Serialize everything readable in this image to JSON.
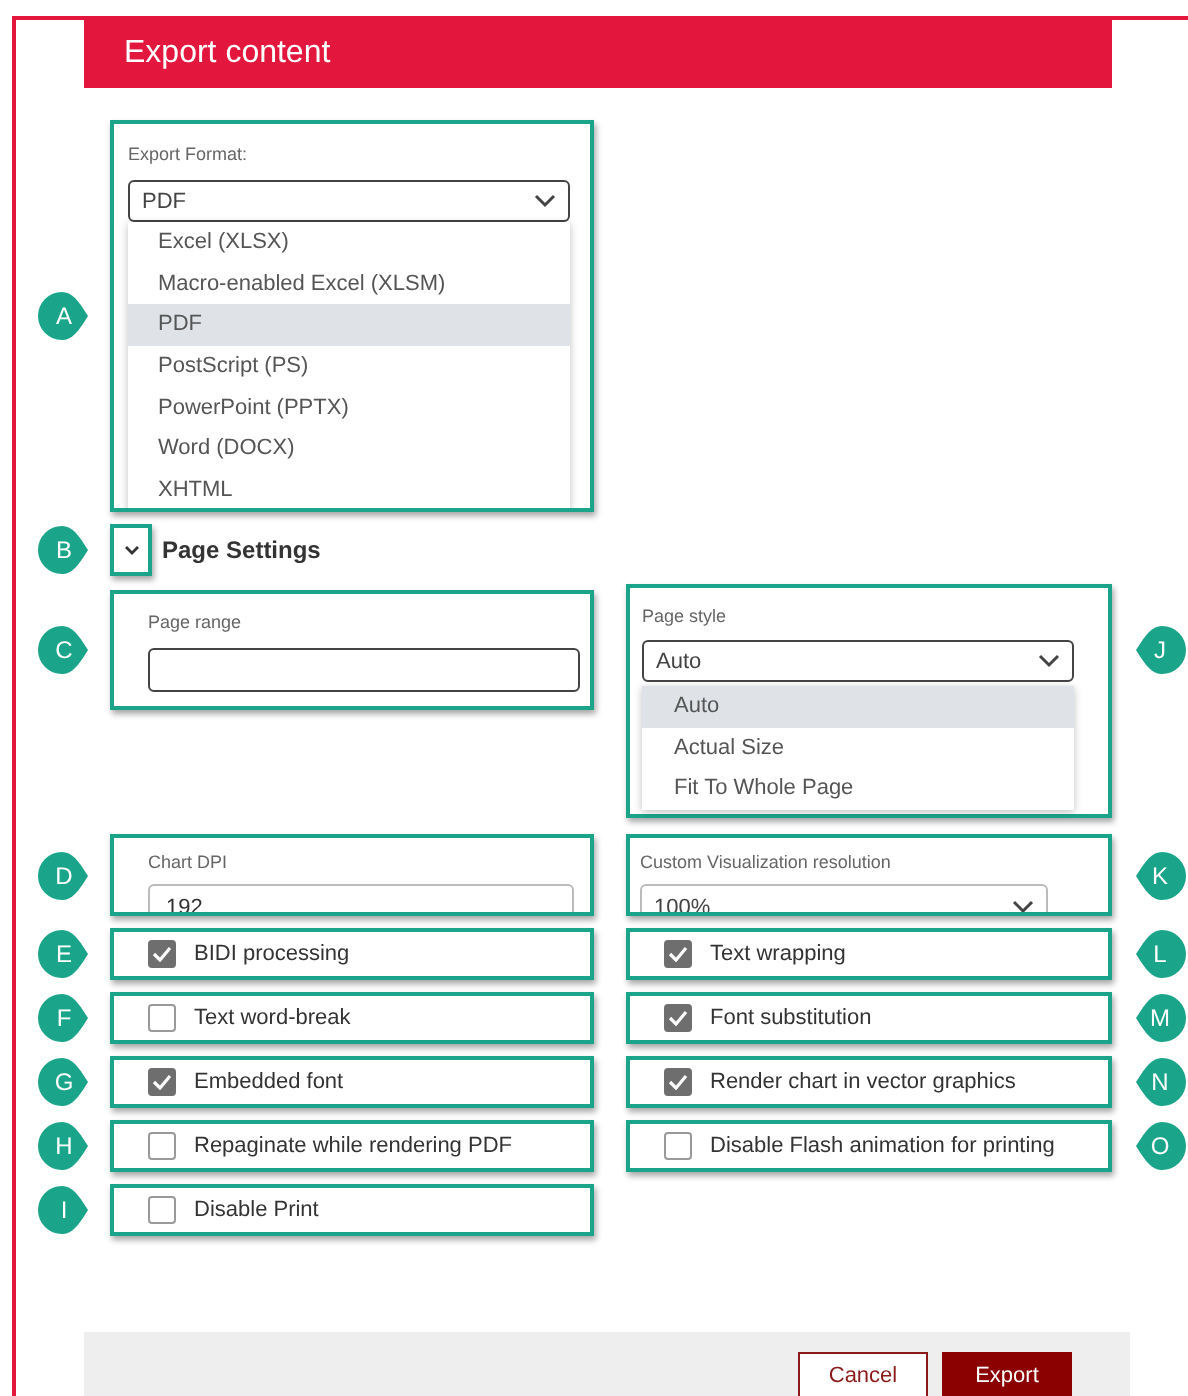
{
  "dialog": {
    "title": "Export content"
  },
  "export_format": {
    "callout": "A",
    "label": "Export Format:",
    "value": "PDF",
    "expanded": true,
    "options": [
      {
        "label": "Excel (XLSX)",
        "selected": false
      },
      {
        "label": "Macro-enabled Excel (XLSM)",
        "selected": false
      },
      {
        "label": "PDF",
        "selected": true
      },
      {
        "label": "PostScript (PS)",
        "selected": false
      },
      {
        "label": "PowerPoint (PPTX)",
        "selected": false
      },
      {
        "label": "Word (DOCX)",
        "selected": false
      },
      {
        "label": "XHTML",
        "selected": false
      }
    ]
  },
  "page_settings": {
    "callout": "B",
    "label": "Page Settings",
    "expanded": true
  },
  "page_range": {
    "callout": "C",
    "label": "Page range"
  },
  "page_style": {
    "callout": "J",
    "label": "Page style",
    "value": "Auto",
    "expanded": true,
    "options": [
      {
        "label": "Auto",
        "selected": true
      },
      {
        "label": "Actual Size",
        "selected": false
      },
      {
        "label": "Fit To Whole Page",
        "selected": false
      }
    ]
  },
  "chart_dpi": {
    "callout": "D",
    "label": "Chart DPI",
    "value": "192"
  },
  "visualization_resolution": {
    "callout": "K",
    "label": "Custom Visualization resolution",
    "value": "100%"
  },
  "options_left": [
    {
      "callout": "E",
      "label": "BIDI processing",
      "checked": true
    },
    {
      "callout": "F",
      "label": "Text word-break",
      "checked": false
    },
    {
      "callout": "G",
      "label": "Embedded font",
      "checked": true
    },
    {
      "callout": "H",
      "label": "Repaginate while rendering PDF",
      "checked": false
    },
    {
      "callout": "I",
      "label": "Disable Print",
      "checked": false
    }
  ],
  "options_right": [
    {
      "callout": "L",
      "label": "Text wrapping",
      "checked": true
    },
    {
      "callout": "M",
      "label": "Font substitution",
      "checked": true
    },
    {
      "callout": "N",
      "label": "Render chart in vector graphics",
      "checked": true
    },
    {
      "callout": "O",
      "label": "Disable Flash animation for printing",
      "checked": false
    }
  ],
  "buttons": [
    {
      "label": "Cancel",
      "kind": "secondary"
    },
    {
      "label": "Export",
      "kind": "primary"
    }
  ]
}
